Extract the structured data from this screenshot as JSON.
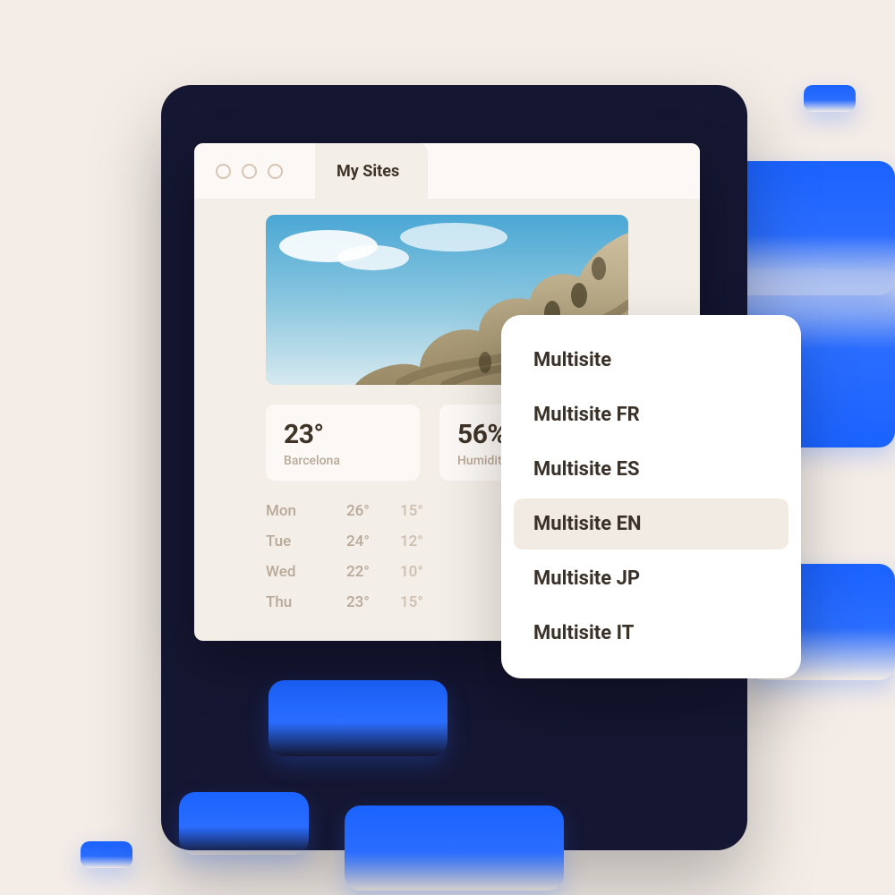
{
  "window": {
    "tab_label": "My Sites"
  },
  "widgets": {
    "temp": {
      "value": "23°",
      "label": "Barcelona"
    },
    "humidity": {
      "value": "56%",
      "label": "Humidity"
    }
  },
  "forecast": [
    {
      "day": "Mon",
      "hi": "26°",
      "lo": "15°"
    },
    {
      "day": "Tue",
      "hi": "24°",
      "lo": "12°"
    },
    {
      "day": "Wed",
      "hi": "22°",
      "lo": "10°"
    },
    {
      "day": "Thu",
      "hi": "23°",
      "lo": "15°"
    }
  ],
  "multisite": {
    "options": [
      {
        "label": "Multisite",
        "selected": false
      },
      {
        "label": "Multisite FR",
        "selected": false
      },
      {
        "label": "Multisite ES",
        "selected": false
      },
      {
        "label": "Multisite EN",
        "selected": true
      },
      {
        "label": "Multisite JP",
        "selected": false
      },
      {
        "label": "Multisite IT",
        "selected": false
      }
    ]
  }
}
